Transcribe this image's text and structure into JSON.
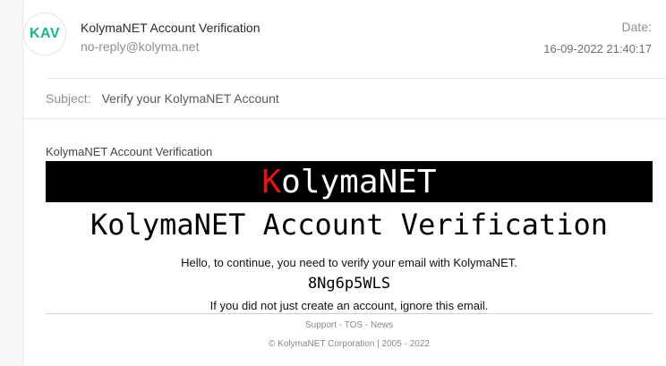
{
  "email": {
    "avatar_initials": "KAV",
    "sender_name": "KolymaNET Account Verification",
    "sender_email": "no-reply@kolyma.net",
    "date_label": "Date:",
    "date_value": "16-09-2022 21:40:17",
    "subject_label": "Subject:",
    "subject_text": "Verify your KolymaNET Account"
  },
  "body": {
    "title": "KolymaNET Account Verification",
    "banner_first_letter": "K",
    "banner_rest": "olymaNET",
    "heading": "KolymaNET Account Verification",
    "hello_text": "Hello, to continue, you need to verify your email with KolymaNET.",
    "code": "8Ng6p5WLS",
    "ignore_text": "If you did not just create an account, ignore this email."
  },
  "footer": {
    "link_support": "Support",
    "sep1": " - ",
    "link_tos": "TOS",
    "sep2": " - ",
    "link_news": "News",
    "copyright": "© KolymaNET Corporation | 2005 - 2022"
  },
  "colors": {
    "avatar_text": "#19b394",
    "banner_bg": "#000000",
    "banner_accent": "#e8141a"
  }
}
